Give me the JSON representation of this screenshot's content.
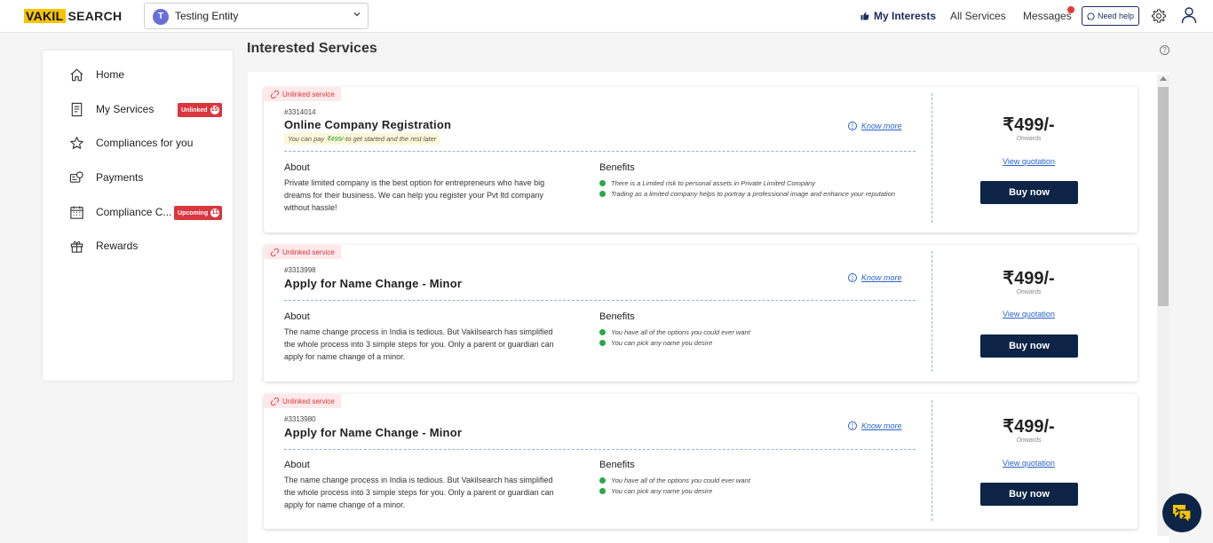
{
  "header": {
    "logo_a": "VAKIL",
    "logo_b": "SEARCH",
    "entity": {
      "initial": "T",
      "name": "Testing Entity"
    },
    "nav": {
      "my_interests": "My Interests",
      "all_services": "All Services",
      "messages": "Messages",
      "need_help": "Need help"
    }
  },
  "sidebar": {
    "items": [
      {
        "label": "Home",
        "icon": "home-icon"
      },
      {
        "label": "My Services",
        "icon": "document-icon",
        "badge": "Unlinked",
        "badge_count": "15"
      },
      {
        "label": "Compliances for you",
        "icon": "star-icon"
      },
      {
        "label": "Payments",
        "icon": "payment-icon"
      },
      {
        "label": "Compliance C...",
        "icon": "calendar-icon",
        "badge": "Upcoming",
        "badge_count": "11"
      },
      {
        "label": "Rewards",
        "icon": "gift-icon"
      }
    ]
  },
  "main": {
    "title": "Interested Services",
    "help": "?",
    "cards": [
      {
        "tag": "Unlinked service",
        "id": "#3314014",
        "title": "Online Company Registration",
        "pay_note_pre": "You can pay ",
        "pay_note_amount": "₹499/-",
        "pay_note_post": "to get started and the rest later",
        "know_more": "Know more",
        "about_heading": "About",
        "about": "Private limited company is the best option for entrepreneurs who have big dreams for their business. We can help you register your Pvt ltd company without hassle!",
        "benefits_heading": "Benefits",
        "benefits": [
          "There is a Limited risk to personal assets in Private Limited Company",
          "Trading as a limited company helps to portray a professional image and enhance your reputation"
        ],
        "price": "₹499/-",
        "onwards": "Onwards",
        "view_quotation": "View quotation",
        "buy": "Buy now"
      },
      {
        "tag": "Unlinked service",
        "id": "#3313998",
        "title": "Apply for Name Change - Minor",
        "know_more": "Know more",
        "about_heading": "About",
        "about": "The name change process in India is tedious. But Vakilsearch has simplified the whole process into 3 simple steps for you. Only a parent or guardian can apply for name change of a minor.",
        "benefits_heading": "Benefits",
        "benefits": [
          "You have all of the options you could ever want",
          "You can pick any name you desire"
        ],
        "price": "₹499/-",
        "onwards": "Onwards",
        "view_quotation": "View quotation",
        "buy": "Buy now"
      },
      {
        "tag": "Unlinked service",
        "id": "#3313980",
        "title": "Apply for Name Change - Minor",
        "know_more": "Know more",
        "about_heading": "About",
        "about": "The name change process in India is tedious. But Vakilsearch has simplified the whole process into 3 simple steps for you. Only a parent or guardian can apply for name change of a minor.",
        "benefits_heading": "Benefits",
        "benefits": [
          "You have all of the options you could ever want",
          "You can pick any name you desire"
        ],
        "price": "₹499/-",
        "onwards": "Onwards",
        "view_quotation": "View quotation",
        "buy": "Buy now"
      }
    ]
  },
  "colors": {
    "brand_yellow": "#f5c400",
    "navy": "#0d2447",
    "alert_red": "#d9363e",
    "link_blue": "#2a62c9",
    "check_green": "#2aa84a"
  }
}
